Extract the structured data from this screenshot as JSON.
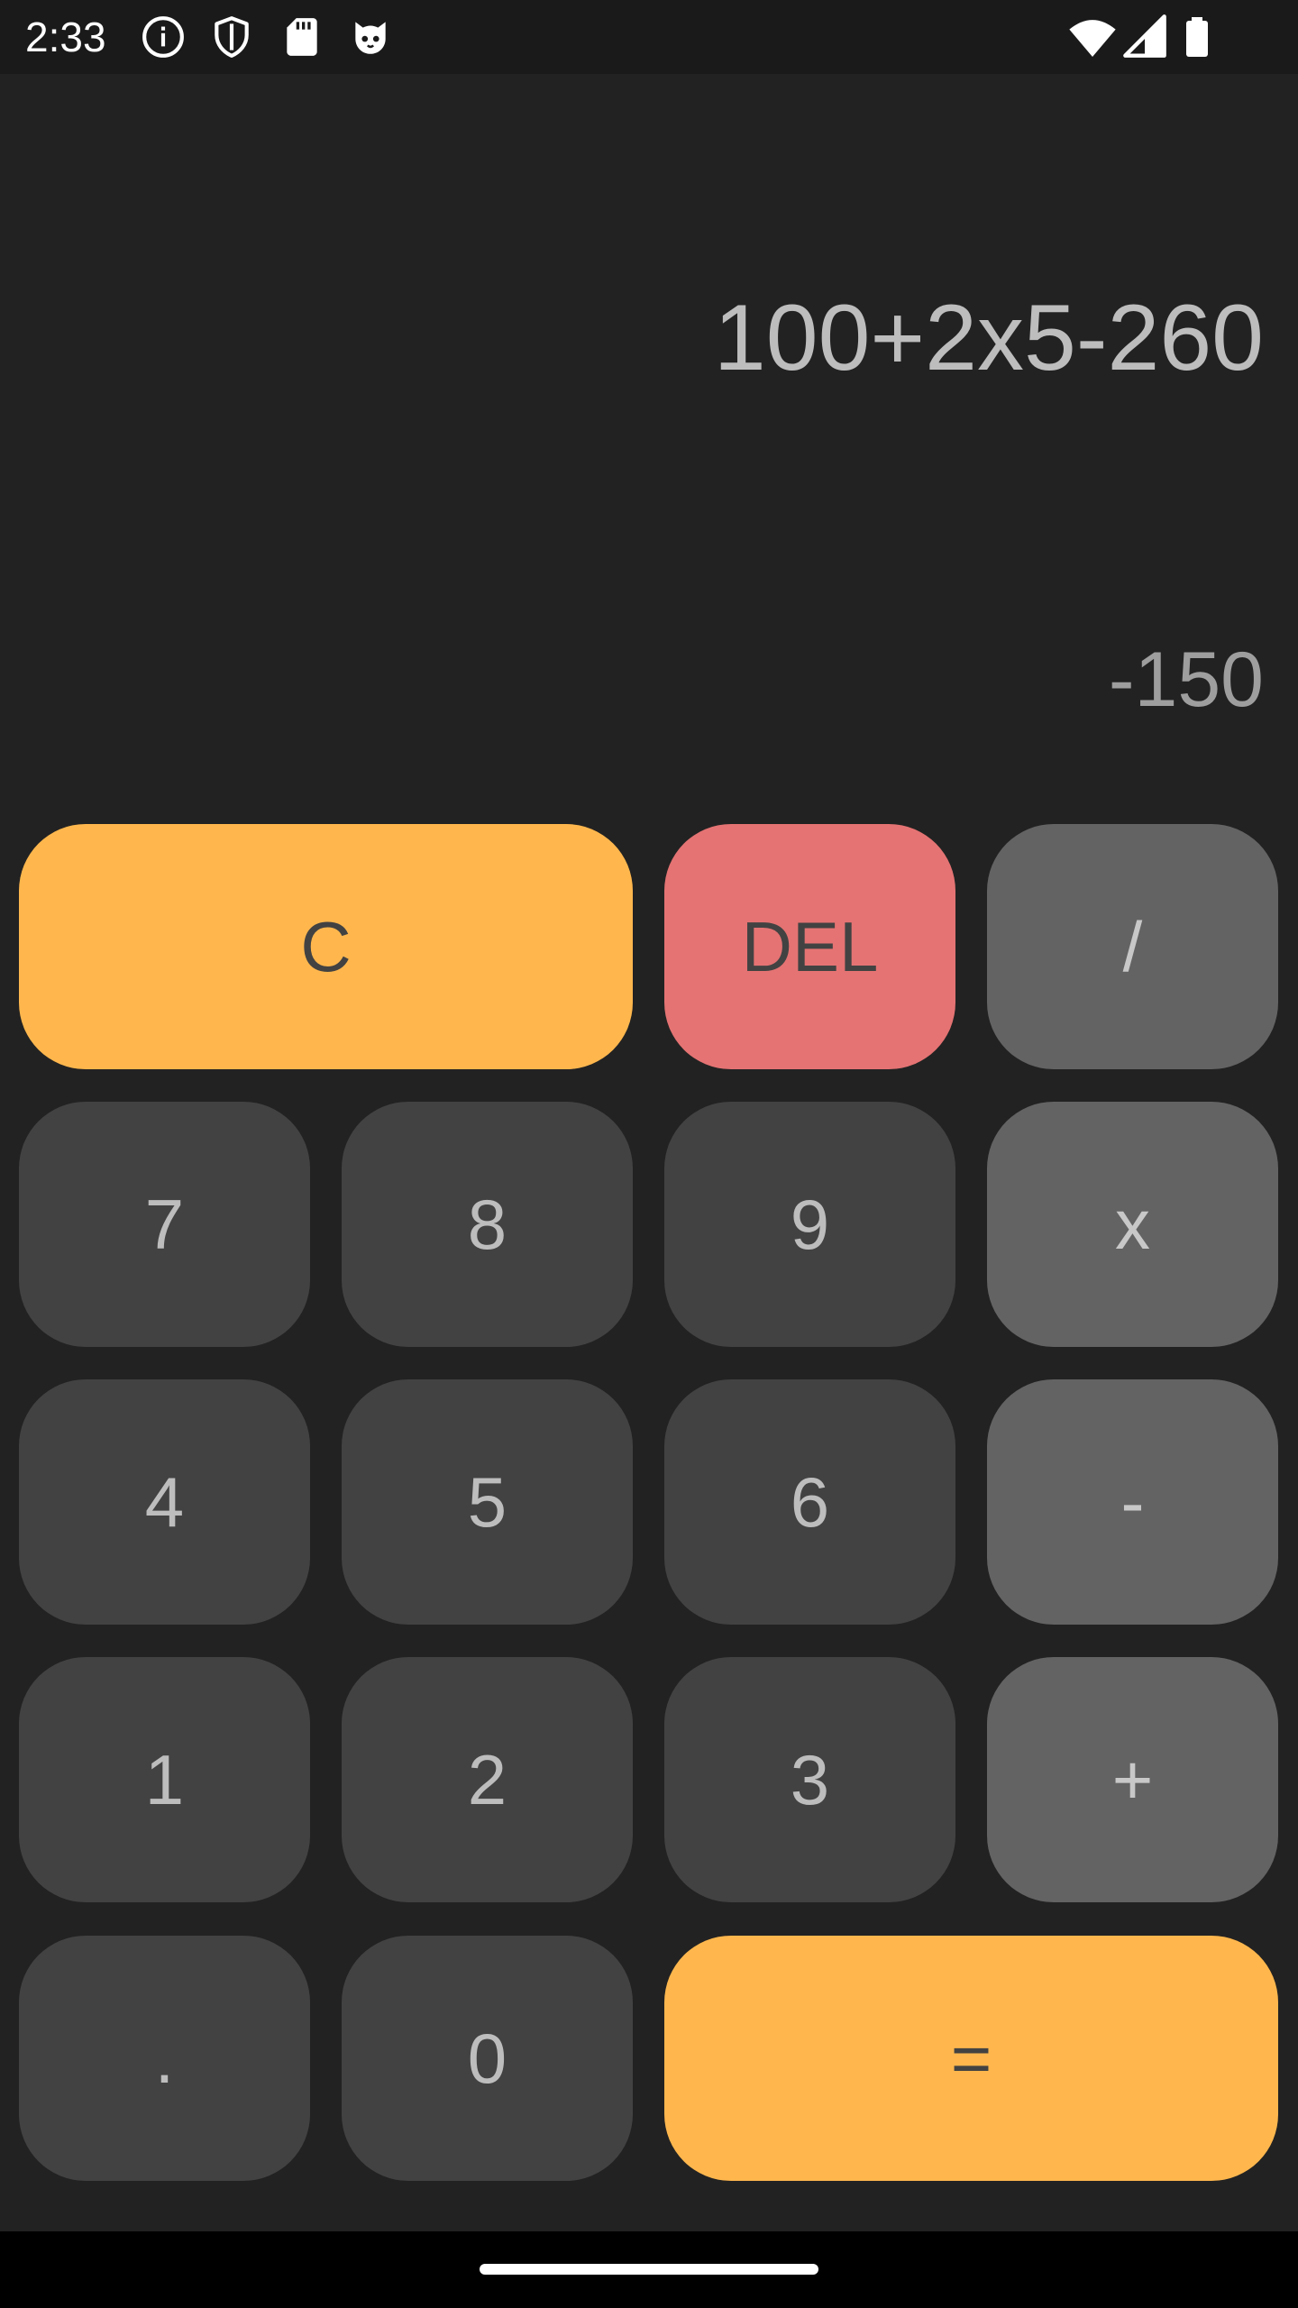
{
  "status_bar": {
    "time": "2:33",
    "icons_left": [
      "info-icon",
      "shield-icon",
      "sd-card-icon",
      "cat-face-icon"
    ],
    "icons_right": [
      "wifi-icon",
      "cellular-signal-icon",
      "battery-icon"
    ]
  },
  "display": {
    "expression": "100+2x5-260",
    "result": "-150"
  },
  "keys": {
    "clear": "C",
    "delete": "DEL",
    "divide": "/",
    "seven": "7",
    "eight": "8",
    "nine": "9",
    "multiply": "x",
    "four": "4",
    "five": "5",
    "six": "6",
    "subtract": "-",
    "one": "1",
    "two": "2",
    "three": "3",
    "add": "+",
    "decimal": ".",
    "zero": "0",
    "equals": "="
  },
  "colors": {
    "background": "#222222",
    "digit_key": "#424242",
    "operator_key": "#636363",
    "accent_yellow": "#ffb74d",
    "accent_red": "#e57373"
  }
}
